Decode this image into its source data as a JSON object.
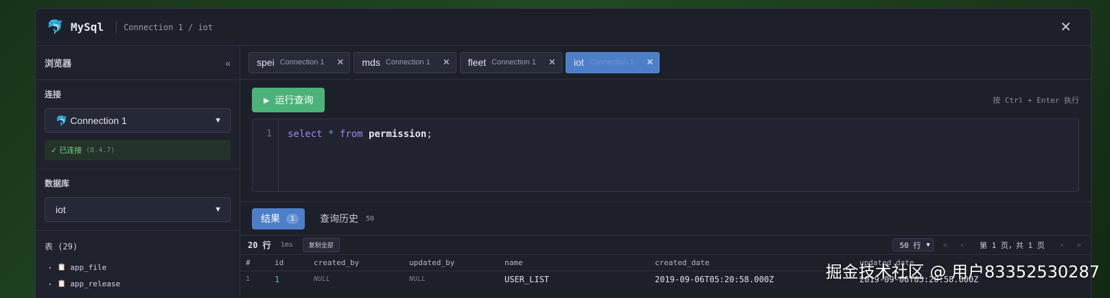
{
  "titlebar": {
    "app_icon": "🐬",
    "app_name": "MySql",
    "breadcrumb": "Connection 1 / iot",
    "close": "✕"
  },
  "sidebar": {
    "title": "浏览器",
    "collapse": "«",
    "connection_label": "连接",
    "connection_value": "🐬 Connection 1",
    "status_text": "✓ 已连接",
    "status_version": "(8.4.7)",
    "database_label": "数据库",
    "database_value": "iot",
    "tables_header": "表 (29)",
    "tables": [
      {
        "arrow": "▸",
        "icon": "📋",
        "name": "app_file"
      },
      {
        "arrow": "▸",
        "icon": "📋",
        "name": "app_release"
      }
    ]
  },
  "tabs": [
    {
      "name": "spei",
      "sub": "Connection 1",
      "close": "✕"
    },
    {
      "name": "mds",
      "sub": "Connection 1",
      "close": "✕"
    },
    {
      "name": "fleet",
      "sub": "Connection 1",
      "close": "✕"
    },
    {
      "name": "iot",
      "sub": "Connection 1",
      "close": "✕"
    }
  ],
  "editor": {
    "run_icon": "▶",
    "run_label": "运行查询",
    "hint": "按 Ctrl + Enter 执行",
    "line_number": "1",
    "code": {
      "kw1": "select",
      "star": "*",
      "kw2": "from",
      "ident": "permission",
      "semi": ";"
    }
  },
  "results": {
    "tab_results": "结果",
    "tab_results_count": "1",
    "tab_history": "查询历史",
    "tab_history_count": "50",
    "rows": "20 行",
    "time": "1ms",
    "copy_all": "复制全部",
    "page_size": "50 行",
    "first": "«",
    "prev": "‹",
    "page_info": "第 1 页，共 1 页",
    "next": "›",
    "last": "»",
    "columns": [
      "#",
      "id",
      "created_by",
      "updated_by",
      "name",
      "created_date",
      "updated_date"
    ],
    "row1": [
      "1",
      "1",
      "NULL",
      "NULL",
      "USER_LIST",
      "2019-09-06T05:20:58.000Z",
      "2019-09-06T05:20:58.000Z"
    ]
  },
  "watermark": "掘金技术社区 @ 用户83352530287"
}
